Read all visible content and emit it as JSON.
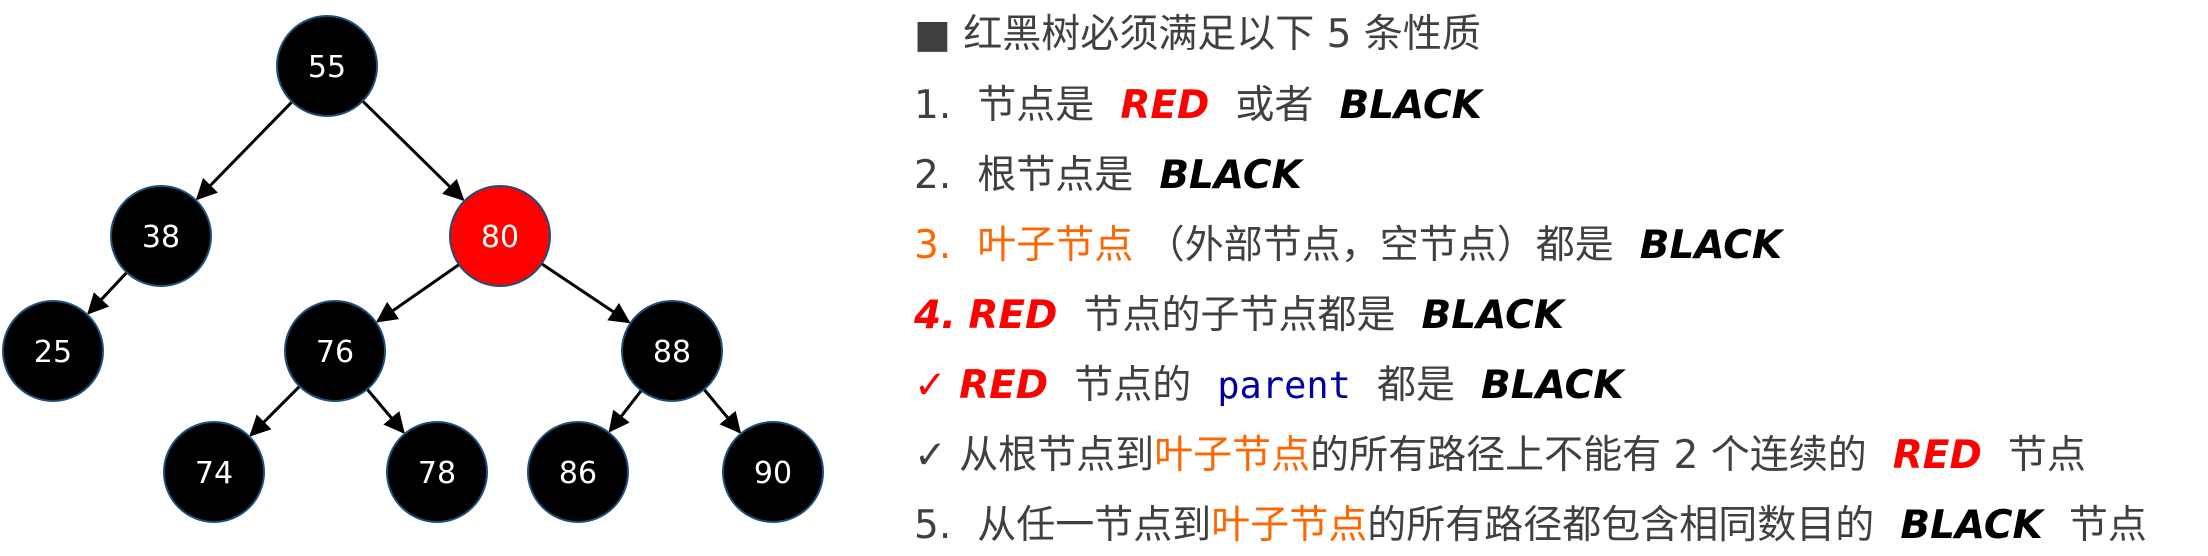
{
  "tree": {
    "nodes": [
      {
        "id": "55",
        "label": "55",
        "color": "black",
        "parent": null
      },
      {
        "id": "38",
        "label": "38",
        "color": "black",
        "parent": "55"
      },
      {
        "id": "80",
        "label": "80",
        "color": "red",
        "parent": "55"
      },
      {
        "id": "25",
        "label": "25",
        "color": "black",
        "parent": "38"
      },
      {
        "id": "76",
        "label": "76",
        "color": "black",
        "parent": "80"
      },
      {
        "id": "88",
        "label": "88",
        "color": "black",
        "parent": "80"
      },
      {
        "id": "74",
        "label": "74",
        "color": "black",
        "parent": "76"
      },
      {
        "id": "78",
        "label": "78",
        "color": "black",
        "parent": "76"
      },
      {
        "id": "86",
        "label": "86",
        "color": "black",
        "parent": "88"
      },
      {
        "id": "90",
        "label": "90",
        "color": "black",
        "parent": "88"
      }
    ],
    "colors": {
      "black": "#000000",
      "red": "#ff0000",
      "border": "#1f4e79",
      "edge": "#000000"
    }
  },
  "text": {
    "heading": {
      "bullet": "■",
      "text": "红黑树必须满足以下 5 条性质"
    },
    "p1": {
      "num": "1.",
      "a": "节点是",
      "red": "RED",
      "b": "或者",
      "black": "BLACK"
    },
    "p2": {
      "num": "2.",
      "a": "根节点是",
      "black": "BLACK"
    },
    "p3": {
      "num": "3.",
      "orange": "叶子节点",
      "a": "（外部节点，空节点）都是",
      "black": "BLACK"
    },
    "p4": {
      "num": "4.",
      "red": "RED",
      "a": "节点的子节点都是",
      "black": "BLACK"
    },
    "c1": {
      "check": "✓",
      "red": "RED",
      "a": "节点的",
      "code": "parent",
      "b": "都是",
      "black": "BLACK"
    },
    "c2": {
      "check": "✓",
      "a": "从根节点到",
      "orange": "叶子节点",
      "b": "的所有路径上不能有 2 个连续的",
      "red": "RED",
      "c": "节点"
    },
    "p5": {
      "num": "5.",
      "a": "从任一节点到",
      "orange": "叶子节点",
      "b": "的所有路径都包含相同数目的",
      "black": "BLACK",
      "c": "节点"
    }
  },
  "colors": {
    "red": "#ff0000",
    "orange": "#ff6600",
    "text": "#404040",
    "code": "#0000a0"
  }
}
